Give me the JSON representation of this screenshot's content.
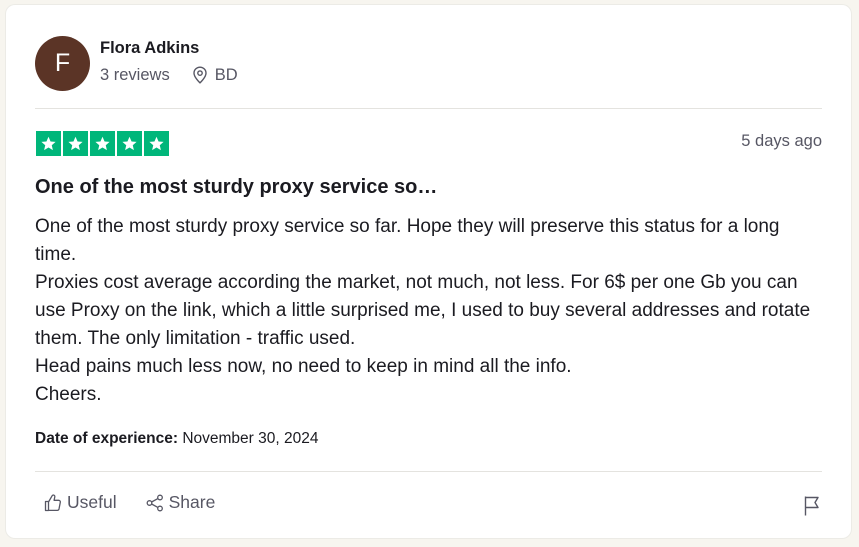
{
  "reviewer": {
    "initial": "F",
    "name": "Flora Adkins",
    "reviews_count": "3 reviews",
    "location": "BD",
    "avatar_color": "#5b3426"
  },
  "review": {
    "rating": 5,
    "star_color": "#00b67a",
    "posted": "5 days ago",
    "title": "One of the most sturdy proxy service so…",
    "body_lines": [
      "One of the most sturdy proxy service so far. Hope they will preserve this status for a long time.",
      "Proxies cost average according the market, not much, not less. For 6$ per one Gb you can use Proxy on the link, which a little surprised me, I used to buy several addresses and rotate them. The only limitation - traffic used.",
      "Head pains much less now, no need to keep in mind all the info.",
      "Cheers."
    ],
    "experience_label": "Date of experience:",
    "experience_date": "November 30, 2024"
  },
  "actions": {
    "useful_label": "Useful",
    "useful_icon": "thumbs-up-icon",
    "share_label": "Share",
    "share_icon": "share-icon",
    "flag_icon": "flag-icon"
  }
}
